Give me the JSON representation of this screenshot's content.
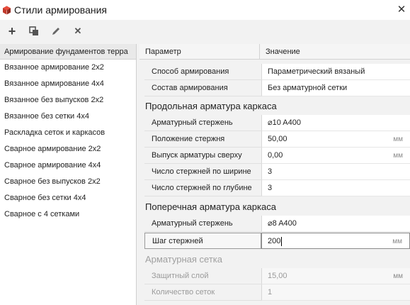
{
  "window": {
    "title": "Стили армирования"
  },
  "toolbar": {
    "add": "+",
    "copy": "⧉",
    "edit": "✎",
    "delete": "✕"
  },
  "styles_list": {
    "header": "Армирование фундаментов терра",
    "items": [
      "Вязанное армирование 2х2",
      "Вязанное армирование 4х4",
      "Вязанное без выпусков 2х2",
      "Вязанное без сетки 4х4",
      "Раскладка сеток и каркасов",
      "Сварное армирование 2х2",
      "Сварное армирование 4х4",
      "Сварное без выпусков 2х2",
      "Сварное без сетки 4х4",
      "Сварное с 4 сетками"
    ]
  },
  "grid": {
    "col_param": "Параметр",
    "col_value": "Значение",
    "general": [
      {
        "param": "Способ армирования",
        "value": "Параметрический вязаный",
        "unit": ""
      },
      {
        "param": "Состав армирования",
        "value": "Без арматурной сетки",
        "unit": ""
      }
    ],
    "sections": {
      "longitudinal": "Продольная арматура каркаса",
      "transverse": "Поперечная арматура каркаса",
      "mesh": "Арматурная сетка"
    },
    "longitudinal": [
      {
        "param": "Арматурный стержень",
        "value": "⌀10 A400",
        "unit": ""
      },
      {
        "param": "Положение стержня",
        "value": "50,00",
        "unit": "мм"
      },
      {
        "param": "Выпуск арматуры сверху",
        "value": "0,00",
        "unit": "мм"
      },
      {
        "param": "Число стержней по ширине",
        "value": "3",
        "unit": ""
      },
      {
        "param": "Число стержней по глубине",
        "value": "3",
        "unit": ""
      }
    ],
    "transverse": [
      {
        "param": "Арматурный стержень",
        "value": "⌀8 A400",
        "unit": ""
      },
      {
        "param": "Шаг стержней",
        "value": "200",
        "unit": "мм"
      }
    ],
    "mesh": [
      {
        "param": "Защитный слой",
        "value": "15,00",
        "unit": "мм"
      },
      {
        "param": "Количество сеток",
        "value": "1",
        "unit": ""
      }
    ]
  }
}
